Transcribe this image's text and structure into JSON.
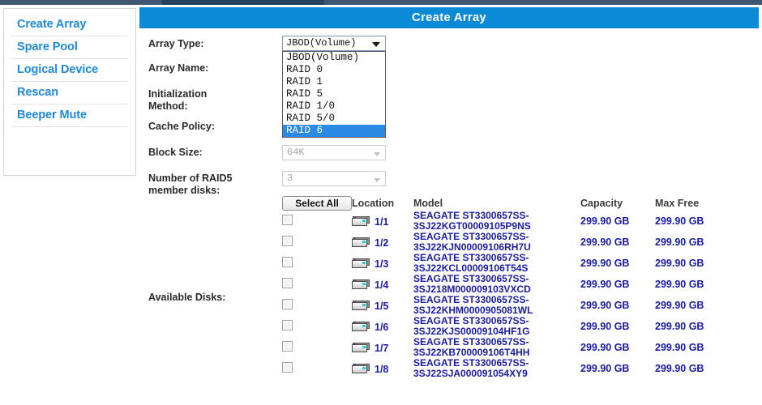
{
  "window": {
    "top_strip_color": "#3f5771",
    "active_tab_color": "#26405e"
  },
  "sidebar": {
    "items": [
      {
        "label": "Create Array"
      },
      {
        "label": "Spare Pool"
      },
      {
        "label": "Logical Device"
      },
      {
        "label": "Rescan"
      },
      {
        "label": "Beeper Mute"
      }
    ]
  },
  "main": {
    "title": "Create Array",
    "title_bar_color": "#0b8ad8",
    "form": {
      "array_type": {
        "label": "Array Type:",
        "value": "JBOD(Volume)",
        "expanded": true,
        "options": [
          "JBOD(Volume)",
          "RAID 0",
          "RAID 1",
          "RAID 5",
          "RAID 1/0",
          "RAID 5/0",
          "RAID 6"
        ],
        "highlighted_option": "RAID 6",
        "highlight_color": "#2a8ae4"
      },
      "array_name": {
        "label": "Array Name:",
        "value": ""
      },
      "initialization_method": {
        "label": "Initialization Method:",
        "value": ""
      },
      "cache_policy": {
        "label": "Cache Policy:",
        "value": ""
      },
      "block_size": {
        "label": "Block Size:",
        "value": "64K",
        "disabled": true
      },
      "raid5_member_disks": {
        "label": "Number of RAID5 member disks:",
        "value": "3",
        "disabled": true
      }
    },
    "disks": {
      "available_disks_label": "Available Disks:",
      "select_all_label": "Select All",
      "columns": [
        "Location",
        "Model",
        "Capacity",
        "Max Free"
      ],
      "rows": [
        {
          "location": "1/1",
          "model": "SEAGATE ST3300657SS-3SJ22KGT00009105P9NS",
          "capacity": "299.90 GB",
          "max_free": "299.90 GB",
          "checked": false
        },
        {
          "location": "1/2",
          "model": "SEAGATE ST3300657SS-3SJ22KJN00009106RH7U",
          "capacity": "299.90 GB",
          "max_free": "299.90 GB",
          "checked": false
        },
        {
          "location": "1/3",
          "model": "SEAGATE ST3300657SS-3SJ22KCL00009106T54S",
          "capacity": "299.90 GB",
          "max_free": "299.90 GB",
          "checked": false
        },
        {
          "location": "1/4",
          "model": "SEAGATE ST3300657SS-3SJ218M000009103VXCD",
          "capacity": "299.90 GB",
          "max_free": "299.90 GB",
          "checked": false
        },
        {
          "location": "1/5",
          "model": "SEAGATE ST3300657SS-3SJ22KHM0000905081WL",
          "capacity": "299.90 GB",
          "max_free": "299.90 GB",
          "checked": false
        },
        {
          "location": "1/6",
          "model": "SEAGATE ST3300657SS-3SJ22KJS00009104HF1G",
          "capacity": "299.90 GB",
          "max_free": "299.90 GB",
          "checked": false
        },
        {
          "location": "1/7",
          "model": "SEAGATE ST3300657SS-3SJ22KB700009106T4HH",
          "capacity": "299.90 GB",
          "max_free": "299.90 GB",
          "checked": false
        },
        {
          "location": "1/8",
          "model": "SEAGATE ST3300657SS-3SJ22SJA000091054XY9",
          "capacity": "299.90 GB",
          "max_free": "299.90 GB",
          "checked": false
        }
      ]
    }
  }
}
